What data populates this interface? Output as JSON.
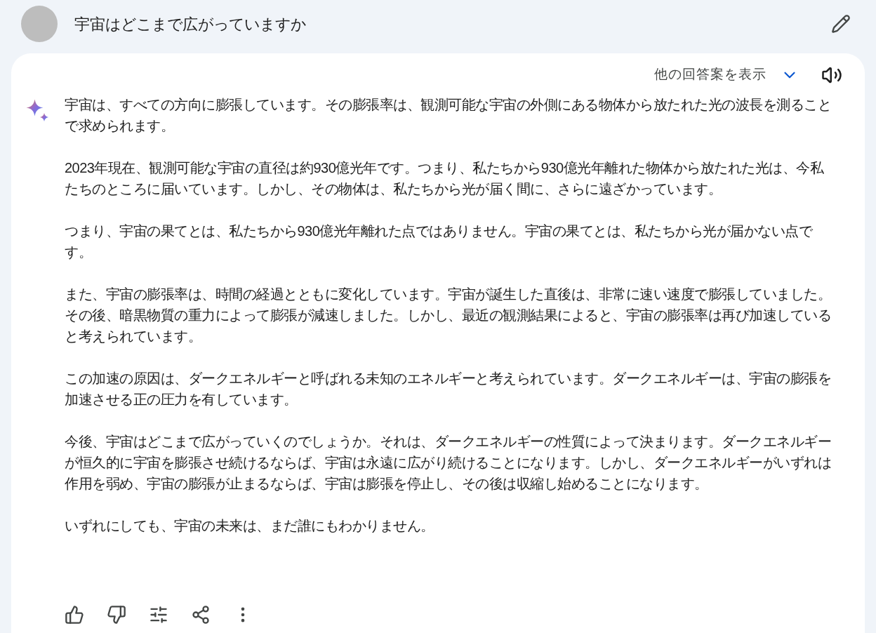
{
  "prompt": {
    "text": "宇宙はどこまで広がっていますか"
  },
  "response": {
    "drafts_label": "他の回答案を表示",
    "paragraphs": [
      "宇宙は、すべての方向に膨張しています。その膨張率は、観測可能な宇宙の外側にある物体から放たれた光の波長を測ることで求められます。",
      "2023年現在、観測可能な宇宙の直径は約930億光年です。つまり、私たちから930億光年離れた物体から放たれた光は、今私たちのところに届いています。しかし、その物体は、私たちから光が届く間に、さらに遠ざかっています。",
      "つまり、宇宙の果てとは、私たちから930億光年離れた点ではありません。宇宙の果てとは、私たちから光が届かない点です。",
      "また、宇宙の膨張率は、時間の経過とともに変化しています。宇宙が誕生した直後は、非常に速い速度で膨張していました。その後、暗黒物質の重力によって膨張が減速しました。しかし、最近の観測結果によると、宇宙の膨張率は再び加速していると考えられています。",
      "この加速の原因は、ダークエネルギーと呼ばれる未知のエネルギーと考えられています。ダークエネルギーは、宇宙の膨張を加速させる正の圧力を有しています。",
      "今後、宇宙はどこまで広がっていくのでしょうか。それは、ダークエネルギーの性質によって決まります。ダークエネルギーが恒久的に宇宙を膨張させ続けるならば、宇宙は永遠に広がり続けることになります。しかし、ダークエネルギーがいずれは作用を弱め、宇宙の膨張が止まるならば、宇宙は膨張を停止し、その後は収縮し始めることになります。",
      "いずれにしても、宇宙の未来は、まだ誰にもわかりません。"
    ],
    "actions": [
      {
        "kind": "like"
      },
      {
        "kind": "dislike"
      },
      {
        "kind": "modify"
      },
      {
        "kind": "share"
      },
      {
        "kind": "more"
      }
    ]
  }
}
